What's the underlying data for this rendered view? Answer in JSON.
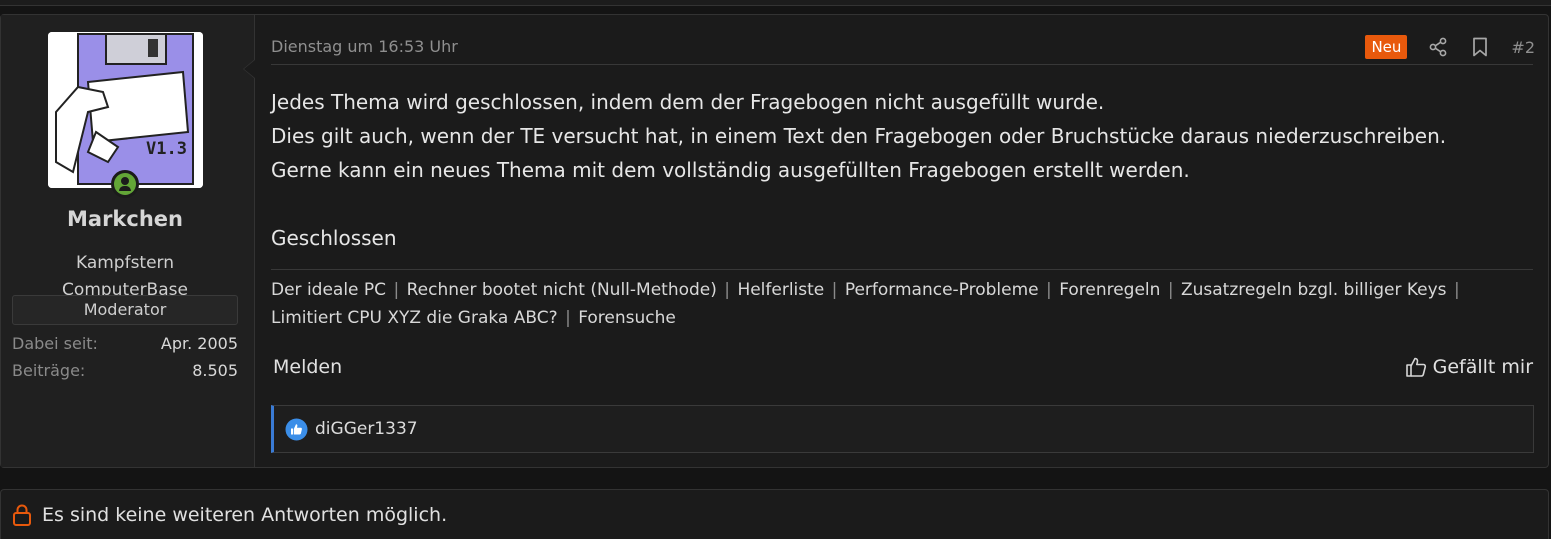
{
  "post": {
    "date": "Dienstag um 16:53 Uhr",
    "new_badge": "Neu",
    "number": "#2",
    "body_lines": [
      "Jedes Thema wird geschlossen, indem dem der Fragebogen nicht ausgefüllt wurde.",
      "Dies gilt auch, wenn der TE versucht hat, in einem Text den Fragebogen oder Bruchstücke daraus niederzuschreiben.",
      "Gerne kann ein neues Thema mit dem vollständig ausgefüllten Fragebogen erstellt werden.",
      "Geschlossen"
    ],
    "signature_links": [
      "Der ideale PC",
      "Rechner bootet nicht (Null-Methode)",
      "Helferliste",
      "Performance-Probleme",
      "Forenregeln",
      "Zusatzregeln bzgl. billiger Keys",
      "Limitiert CPU XYZ die Graka ABC?",
      "Forensuche"
    ],
    "signature_separator": "|",
    "report_label": "Melden",
    "like_label": "Gefällt mir",
    "reaction_user": "diGGer1337"
  },
  "user": {
    "name": "Markchen",
    "title_line1": "Kampfstern",
    "title_line2": "ComputerBase",
    "role": "Moderator",
    "avatar_text": "V1.3",
    "stats": [
      {
        "label": "Dabei seit:",
        "value": "Apr. 2005"
      },
      {
        "label": "Beiträge:",
        "value": "8.505"
      }
    ]
  },
  "thread_status": {
    "message": "Es sind keine weiteren Antworten möglich."
  },
  "colors": {
    "accent_new": "#e8590c",
    "online": "#63a637",
    "reaction_border": "#3a7bd5",
    "lock": "#e8590c"
  },
  "icons": [
    "share-icon",
    "bookmark-icon",
    "thumbs-up-icon",
    "like-reaction-icon",
    "lock-icon",
    "user-online-icon"
  ]
}
